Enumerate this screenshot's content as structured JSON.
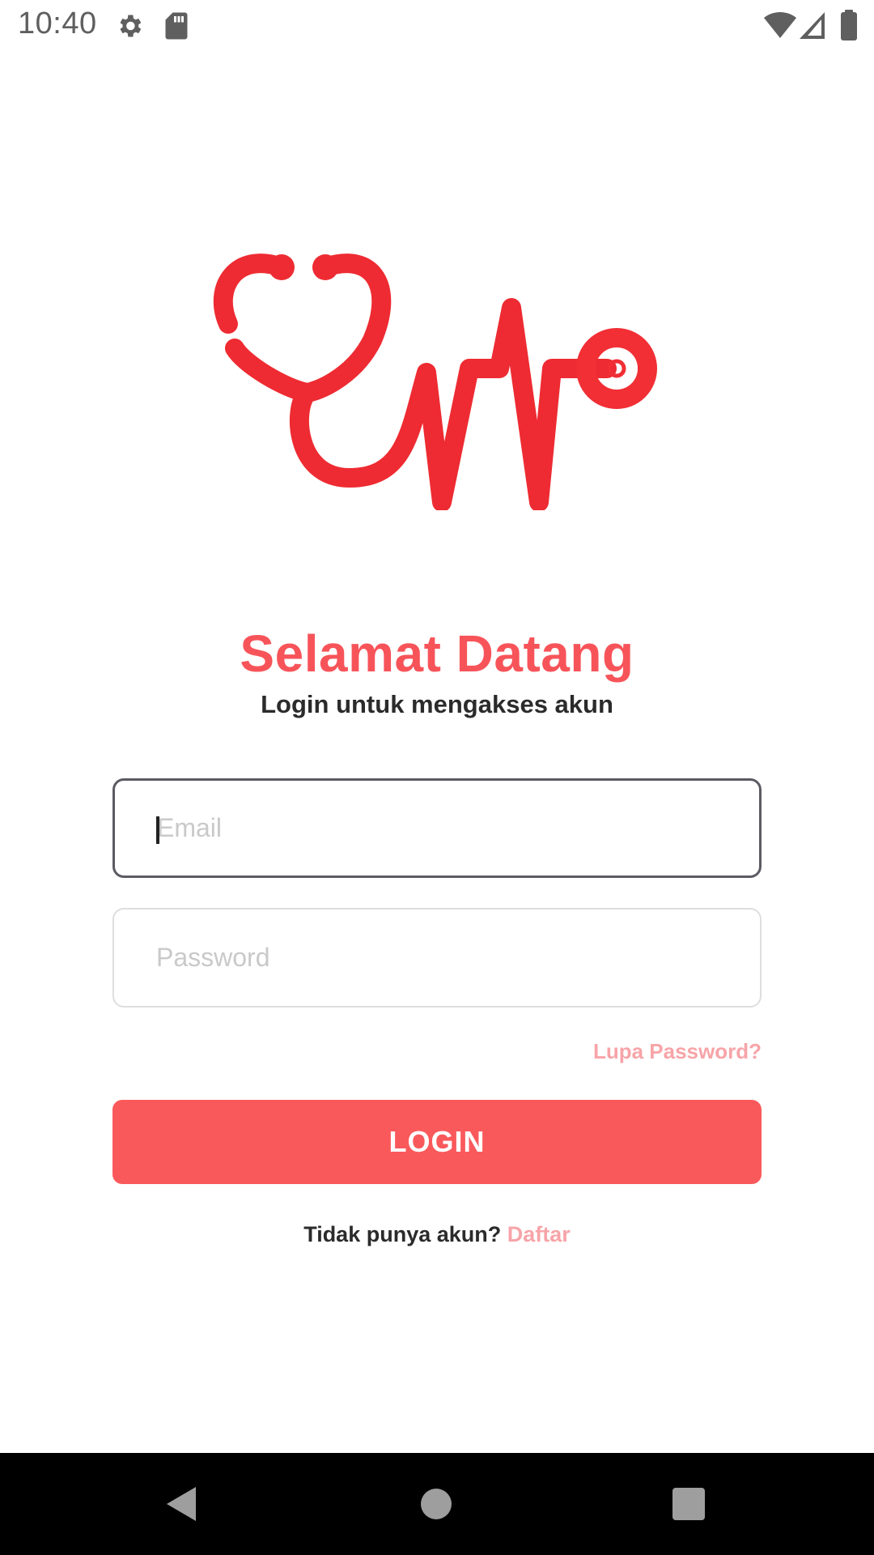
{
  "status_bar": {
    "time": "10:40",
    "icons": [
      "gear-icon",
      "sd-card-icon",
      "wifi-icon",
      "signal-icon",
      "battery-icon"
    ]
  },
  "logo": {
    "icon": "stethoscope-heartbeat-logo",
    "color": "#ee2b32"
  },
  "login": {
    "title": "Selamat Datang",
    "subtitle": "Login untuk mengakses akun",
    "email_placeholder": "Email",
    "password_placeholder": "Password",
    "forgot_label": "Lupa Password?",
    "login_label": "LOGIN",
    "signup_prompt": "Tidak punya akun?",
    "signup_link": "Daftar"
  },
  "colors": {
    "accent": "#f7545a",
    "button": "#fa595c",
    "link": "#f7a4a8"
  },
  "nav_bar": {
    "icons": [
      "back-icon",
      "home-icon",
      "recents-icon"
    ]
  }
}
